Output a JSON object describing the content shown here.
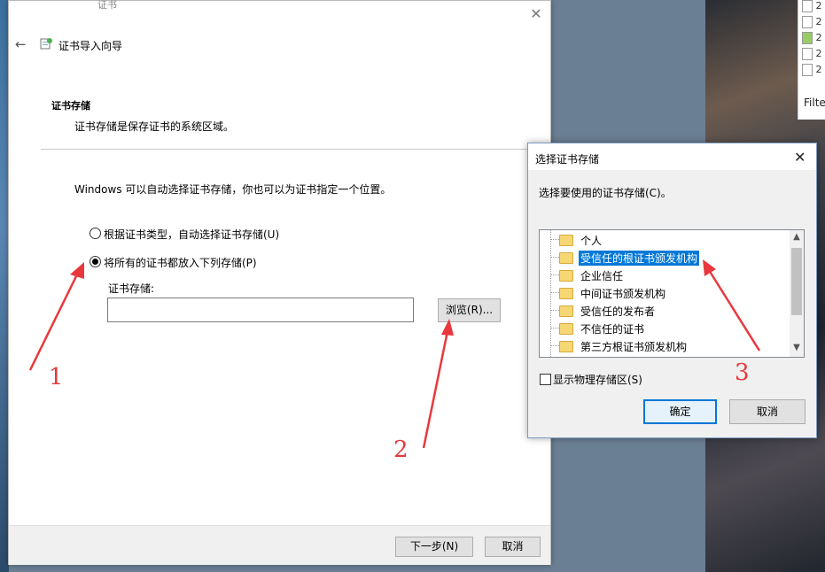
{
  "background": {
    "filter_label": "Filte",
    "file_rows": [
      "2",
      "2",
      "2",
      "2",
      "2"
    ]
  },
  "wizard": {
    "ghost_title": "证书",
    "title": "证书导入向导",
    "section_title": "证书存储",
    "section_desc": "证书存储是保存证书的系统区域。",
    "intro_text": "Windows 可以自动选择证书存储，你也可以为证书指定一个位置。",
    "radio_auto_label": "根据证书类型，自动选择证书存储(U)",
    "radio_manual_label": "将所有的证书都放入下列存储(P)",
    "radio_selected": "manual",
    "store_field_label": "证书存储:",
    "store_field_value": "",
    "browse_label": "浏览(R)...",
    "next_label": "下一步(N)",
    "cancel_label": "取消"
  },
  "store_dialog": {
    "title": "选择证书存储",
    "prompt": "选择要使用的证书存储(C)。",
    "stores": [
      {
        "label": "个人",
        "selected": false
      },
      {
        "label": "受信任的根证书颁发机构",
        "selected": true
      },
      {
        "label": "企业信任",
        "selected": false
      },
      {
        "label": "中间证书颁发机构",
        "selected": false
      },
      {
        "label": "受信任的发布者",
        "selected": false
      },
      {
        "label": "不信任的证书",
        "selected": false
      },
      {
        "label": "第三方根证书颁发机构",
        "selected": false
      }
    ],
    "show_physical_label": "显示物理存储区(S)",
    "show_physical_checked": false,
    "ok_label": "确定",
    "cancel_label": "取消"
  },
  "annotations": {
    "step1": "1",
    "step2": "2",
    "step3": "3",
    "color": "#e8383d"
  },
  "colors": {
    "selection": "#0078d7",
    "folder": "#f7d674"
  }
}
